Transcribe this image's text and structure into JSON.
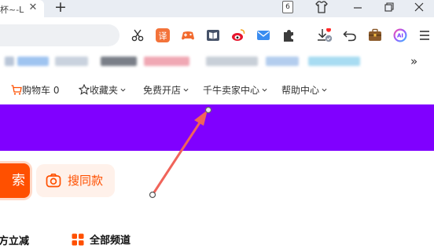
{
  "tab": {
    "title": "杯~-L",
    "close_glyph": "✕",
    "new_tab_glyph": "+"
  },
  "window_controls": {
    "tab_count": "6"
  },
  "toolbar": {
    "icons": [
      "scissors-icon",
      "translate-icon",
      "game-icon",
      "reader-icon",
      "weibo-icon",
      "mail-icon",
      "extensions-icon",
      "download-icon",
      "undo-icon",
      "wallet-icon",
      "ai-icon",
      "menu-icon"
    ],
    "translate_label": "译",
    "ai_label": "AI"
  },
  "bookmarks": {
    "more_glyph": "»"
  },
  "site_nav": {
    "cart": "购物车 0",
    "favorites": "收藏夹",
    "open_store": "免费开店",
    "seller_center": "千牛卖家中心",
    "help_center": "帮助中心"
  },
  "search": {
    "search_button_label": "索",
    "same_item_label": "搜同款"
  },
  "bottom": {
    "left_text": "方立减",
    "all_channels": "全部频道"
  },
  "colors": {
    "banner": "#8000ff",
    "accent": "#ff5000",
    "arrow": "#f0645a"
  }
}
